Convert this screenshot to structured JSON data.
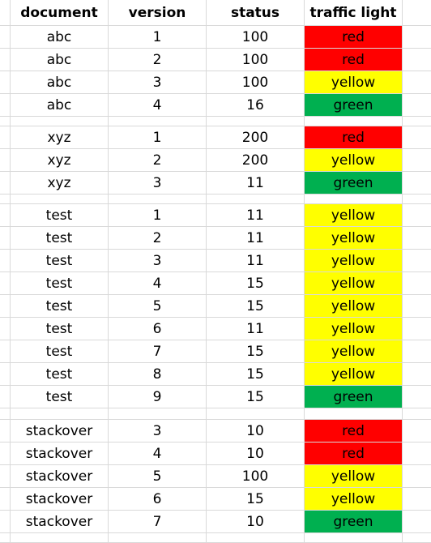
{
  "headers": [
    "document",
    "version",
    "status",
    "traffic light"
  ],
  "colors": {
    "red": "#ff0000",
    "yellow": "#ffff00",
    "green": "#00b050",
    "gridline": "#d9d9d9"
  },
  "groups": [
    {
      "rows": [
        {
          "document": "abc",
          "version": "1",
          "status": "100",
          "traffic": "red"
        },
        {
          "document": "abc",
          "version": "2",
          "status": "100",
          "traffic": "red"
        },
        {
          "document": "abc",
          "version": "3",
          "status": "100",
          "traffic": "yellow"
        },
        {
          "document": "abc",
          "version": "4",
          "status": "16",
          "traffic": "green"
        }
      ]
    },
    {
      "rows": [
        {
          "document": "xyz",
          "version": "1",
          "status": "200",
          "traffic": "red"
        },
        {
          "document": "xyz",
          "version": "2",
          "status": "200",
          "traffic": "yellow"
        },
        {
          "document": "xyz",
          "version": "3",
          "status": "11",
          "traffic": "green"
        }
      ]
    },
    {
      "rows": [
        {
          "document": "test",
          "version": "1",
          "status": "11",
          "traffic": "yellow"
        },
        {
          "document": "test",
          "version": "2",
          "status": "11",
          "traffic": "yellow"
        },
        {
          "document": "test",
          "version": "3",
          "status": "11",
          "traffic": "yellow"
        },
        {
          "document": "test",
          "version": "4",
          "status": "15",
          "traffic": "yellow"
        },
        {
          "document": "test",
          "version": "5",
          "status": "15",
          "traffic": "yellow"
        },
        {
          "document": "test",
          "version": "6",
          "status": "11",
          "traffic": "yellow"
        },
        {
          "document": "test",
          "version": "7",
          "status": "15",
          "traffic": "yellow"
        },
        {
          "document": "test",
          "version": "8",
          "status": "15",
          "traffic": "yellow"
        },
        {
          "document": "test",
          "version": "9",
          "status": "15",
          "traffic": "green"
        }
      ]
    },
    {
      "rows": [
        {
          "document": "stackover",
          "version": "3",
          "status": "10",
          "traffic": "red"
        },
        {
          "document": "stackover",
          "version": "4",
          "status": "10",
          "traffic": "red"
        },
        {
          "document": "stackover",
          "version": "5",
          "status": "100",
          "traffic": "yellow"
        },
        {
          "document": "stackover",
          "version": "6",
          "status": "15",
          "traffic": "yellow"
        },
        {
          "document": "stackover",
          "version": "7",
          "status": "10",
          "traffic": "green"
        }
      ]
    }
  ]
}
